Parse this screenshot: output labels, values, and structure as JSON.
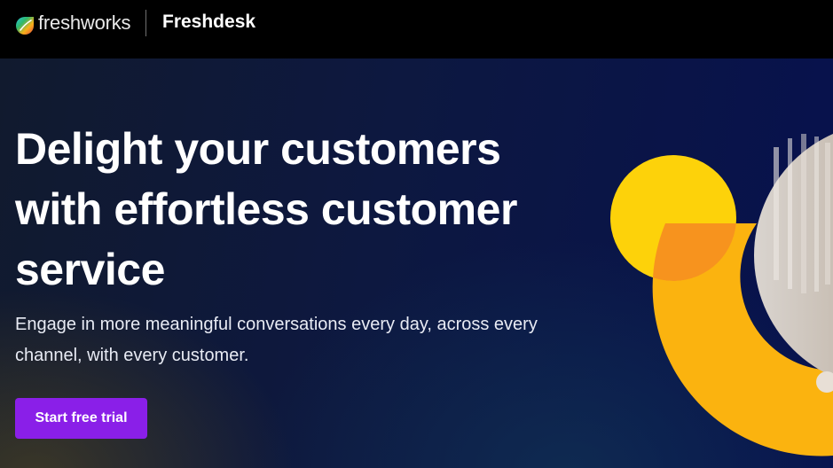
{
  "header": {
    "company_name": "freshworks",
    "product_name": "Freshdesk",
    "logo_icon": "freshworks-logo-icon"
  },
  "hero": {
    "headline": "Delight your customers with effortless customer service",
    "subtext": "Engage in more meaningful conversations every day, across every channel, with every customer.",
    "cta_label": "Start free trial"
  },
  "colors": {
    "topbar": "#000000",
    "cta": "#8a1fe8",
    "circle_yellow": "#fdd20a",
    "arc_orange": "#fbb30f",
    "overlap_orange": "#f7931e"
  }
}
